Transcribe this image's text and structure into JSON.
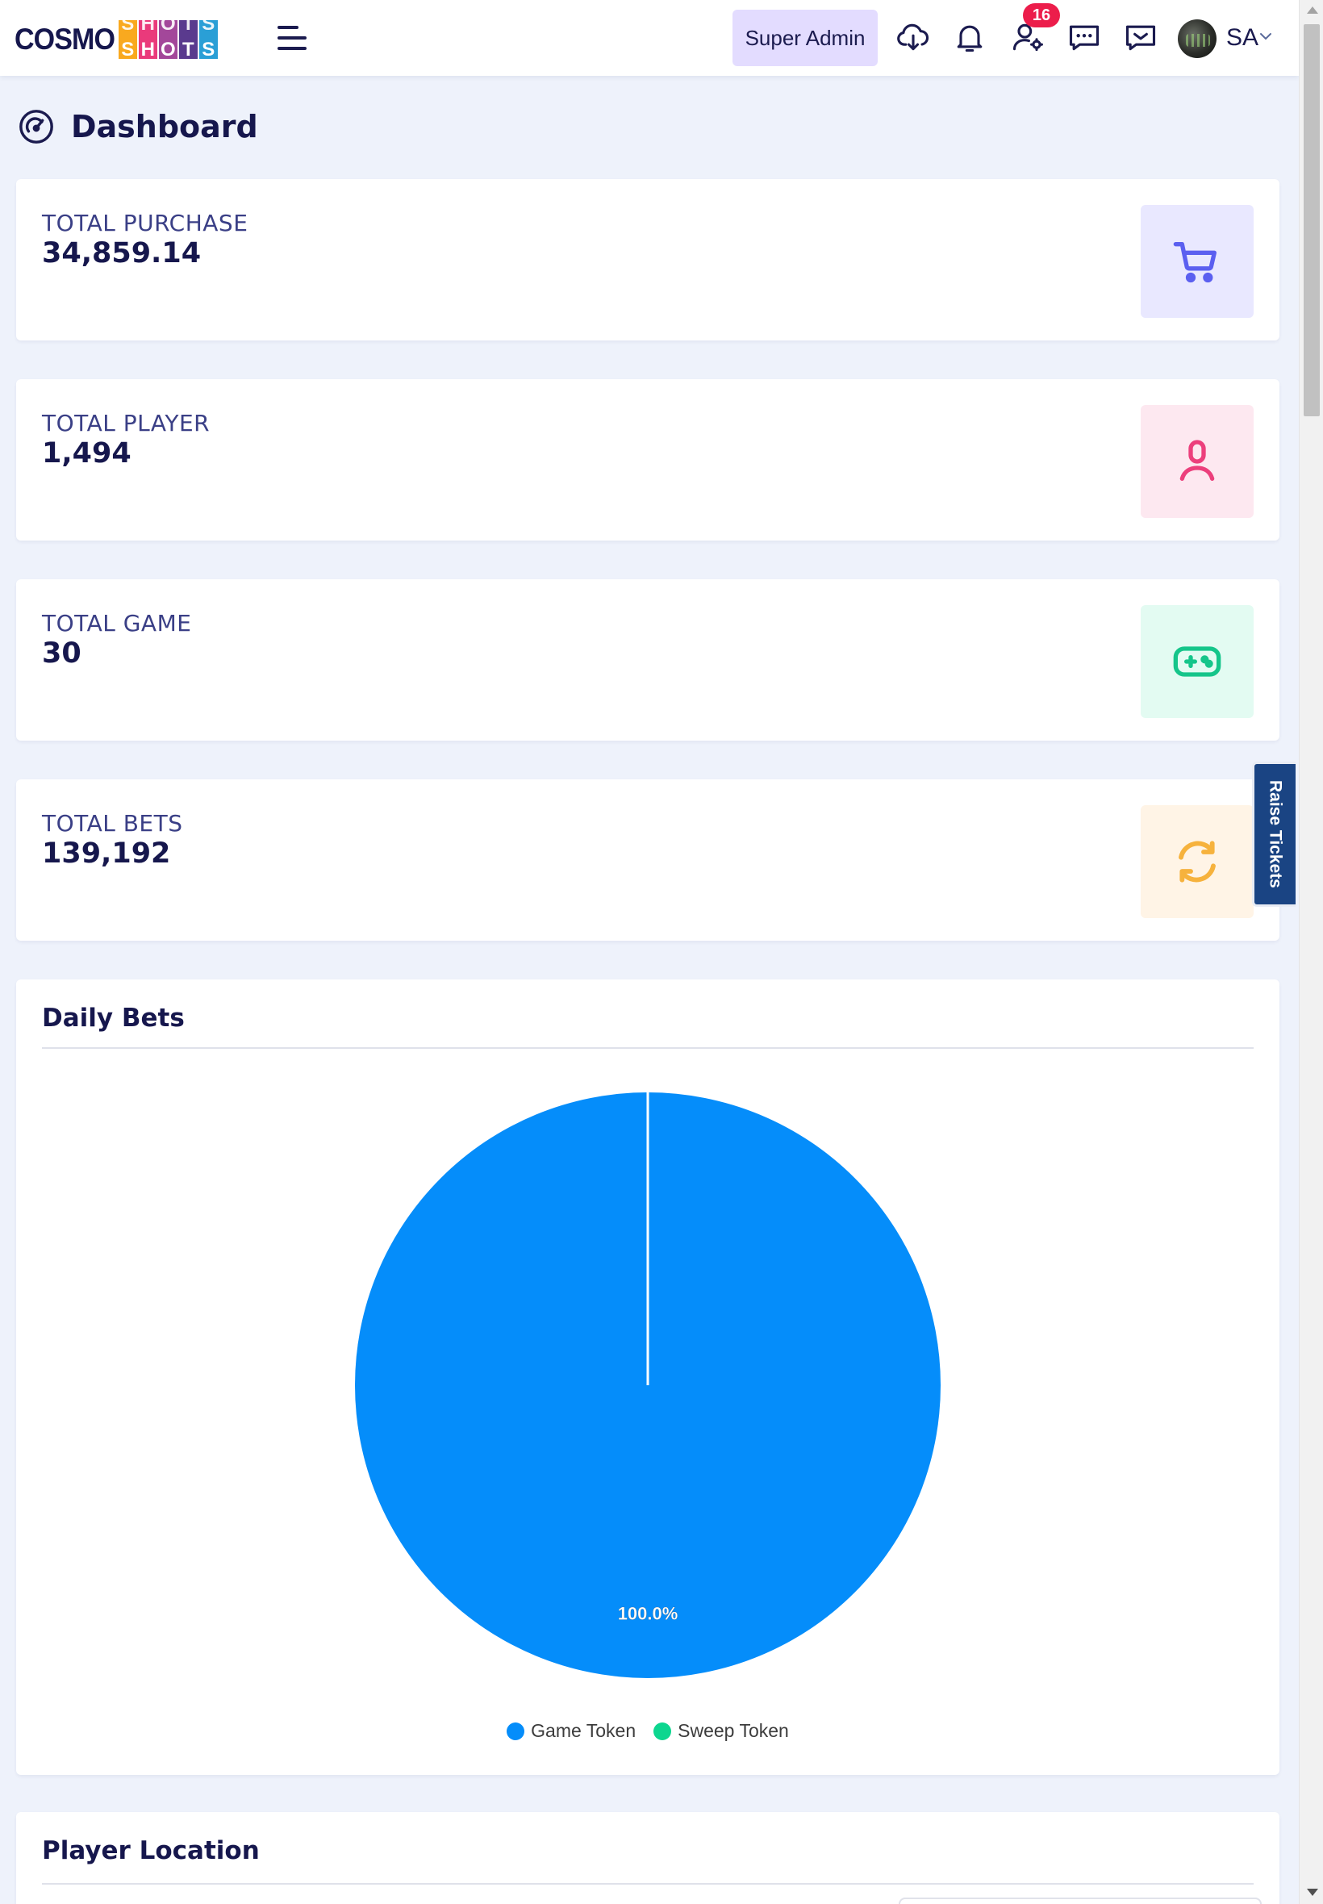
{
  "header": {
    "logo": {
      "part1": "COSMO",
      "tiles": [
        {
          "letter": "S",
          "color": "#f9a91f"
        },
        {
          "letter": "H",
          "color": "#ea3a7b"
        },
        {
          "letter": "O",
          "color": "#a3479a"
        },
        {
          "letter": "T",
          "color": "#5a3a8e"
        },
        {
          "letter": "S",
          "color": "#2a9fd6"
        }
      ]
    },
    "role_label": "Super Admin",
    "notification_count": "16",
    "user_initials": "SA",
    "icons": [
      "menu-icon",
      "cloud-download-icon",
      "bell-icon",
      "user-settings-icon",
      "chat-icon",
      "inbox-message-icon",
      "chevron-down-icon"
    ]
  },
  "page": {
    "title": "Dashboard",
    "title_icon": "speedometer-icon"
  },
  "stats": [
    {
      "label": "TOTAL PURCHASE",
      "value": "34,859.14",
      "icon": "cart-icon",
      "icon_color": "#5b5ff0",
      "icon_bg": "#e9e8ff"
    },
    {
      "label": "TOTAL PLAYER",
      "value": "1,494",
      "icon": "user-icon",
      "icon_color": "#ec3f7c",
      "icon_bg": "#fde8f0"
    },
    {
      "label": "TOTAL GAME",
      "value": "30",
      "icon": "gamepad-icon",
      "icon_color": "#15c58a",
      "icon_bg": "#e3fbf2"
    },
    {
      "label": "TOTAL BETS",
      "value": "139,192",
      "icon": "refresh-icon",
      "icon_color": "#f6b23d",
      "icon_bg": "#fff4e6"
    }
  ],
  "raise_tickets": "Raise Tickets",
  "daily_bets": {
    "title": "Daily Bets",
    "chart_data": {
      "type": "pie",
      "slices": [
        {
          "name": "Game Token",
          "percent": 100.0,
          "color": "#058dfa"
        },
        {
          "name": "Sweep Token",
          "percent": 0.0,
          "color": "#0dd68f"
        }
      ],
      "data_labels": [
        "100.0%"
      ],
      "legend": [
        "Game Token",
        "Sweep Token"
      ],
      "legend_position": "bottom"
    }
  },
  "player_location": {
    "title": "Player Location"
  }
}
